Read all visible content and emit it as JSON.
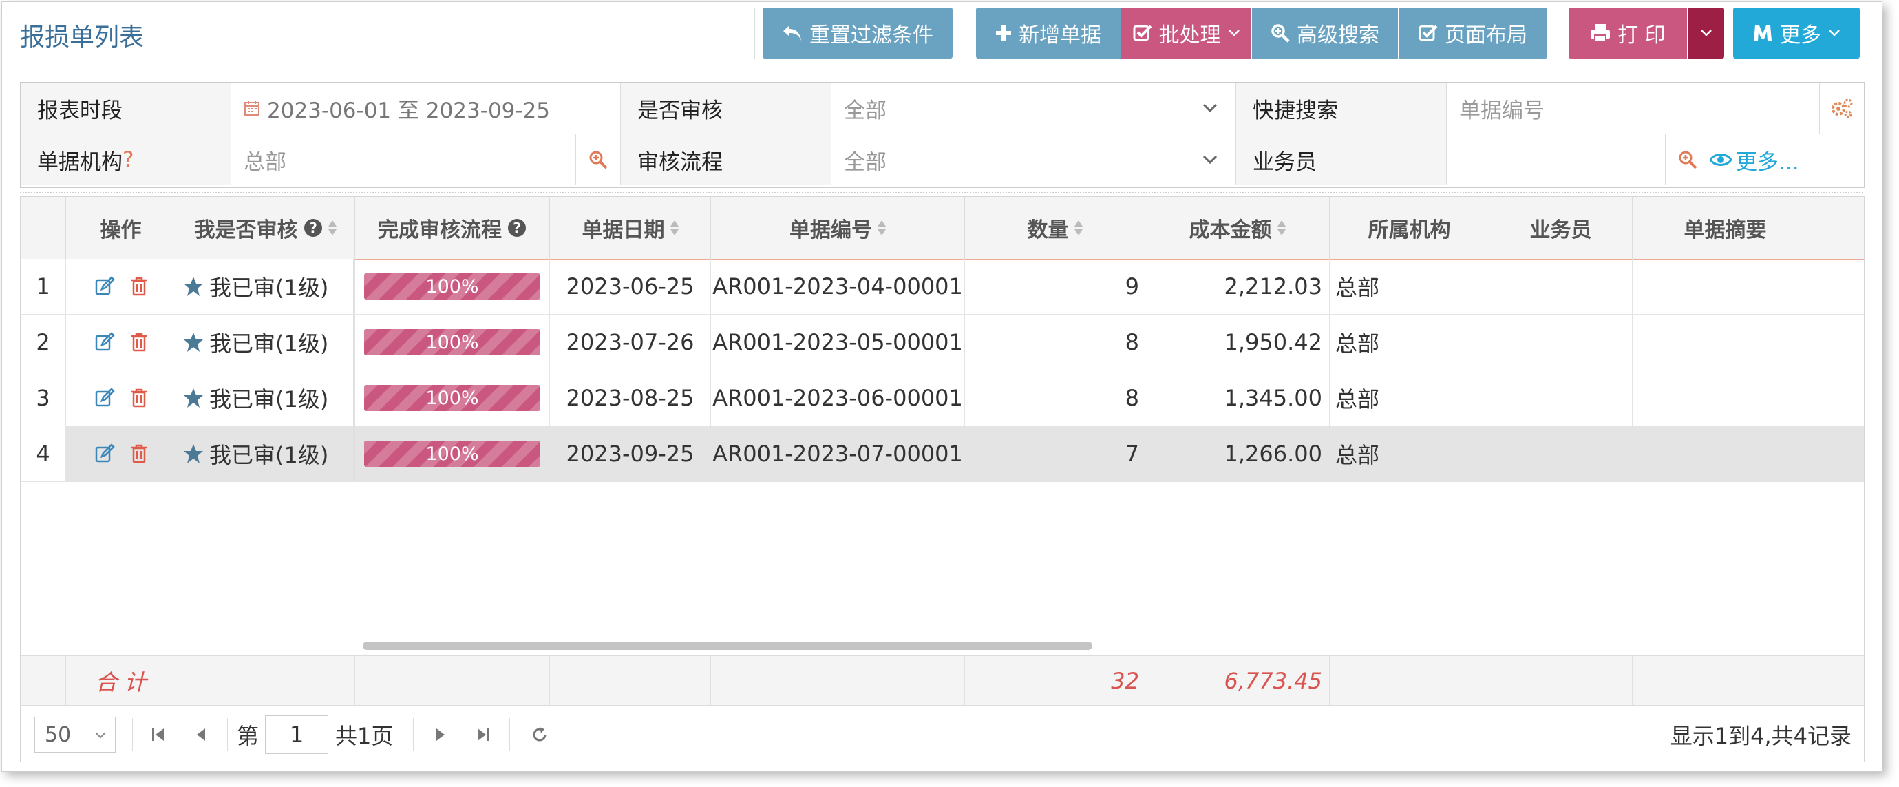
{
  "page": {
    "title": "报损单列表"
  },
  "toolbar": {
    "reset": "重置过滤条件",
    "add": "新增单据",
    "batch": "批处理",
    "advanced_search": "高级搜索",
    "layout": "页面布局",
    "print": "打 印",
    "more": "更多"
  },
  "filters": {
    "period_label": "报表时段",
    "period_value": "2023-06-01 至 2023-09-25",
    "audited_label": "是否审核",
    "audited_value": "全部",
    "quick_label": "快捷搜索",
    "quick_placeholder": "单据编号",
    "org_label": "单据机构",
    "org_q": "?",
    "org_value": "总部",
    "flow_label": "审核流程",
    "flow_value": "全部",
    "staff_label": "业务员",
    "more_link": "更多..."
  },
  "table": {
    "headers": {
      "op": "操作",
      "audited": "我是否审核",
      "flow": "完成审核流程",
      "date": "单据日期",
      "no": "单据编号",
      "qty": "数量",
      "cost": "成本金额",
      "org": "所属机构",
      "staff": "业务员",
      "summary": "单据摘要"
    },
    "rows": [
      {
        "idx": "1",
        "audited": "我已审(1级)",
        "progress": "100%",
        "date": "2023-06-25",
        "no": "AR001-2023-04-00001",
        "qty": "9",
        "cost": "2,212.03",
        "org": "总部",
        "staff": "",
        "summary": ""
      },
      {
        "idx": "2",
        "audited": "我已审(1级)",
        "progress": "100%",
        "date": "2023-07-26",
        "no": "AR001-2023-05-00001",
        "qty": "8",
        "cost": "1,950.42",
        "org": "总部",
        "staff": "",
        "summary": ""
      },
      {
        "idx": "3",
        "audited": "我已审(1级)",
        "progress": "100%",
        "date": "2023-08-25",
        "no": "AR001-2023-06-00001",
        "qty": "8",
        "cost": "1,345.00",
        "org": "总部",
        "staff": "",
        "summary": ""
      },
      {
        "idx": "4",
        "audited": "我已审(1级)",
        "progress": "100%",
        "date": "2023-09-25",
        "no": "AR001-2023-07-00001",
        "qty": "7",
        "cost": "1,266.00",
        "org": "总部",
        "staff": "",
        "summary": ""
      }
    ],
    "footer": {
      "label": "合 计",
      "qty": "32",
      "cost": "6,773.45"
    }
  },
  "pager": {
    "page_size": "50",
    "page_prefix": "第",
    "page": "1",
    "page_suffix": "共1页",
    "info": "显示1到4,共4记录"
  },
  "colors": {
    "blue": "#6aa3c2",
    "pink": "#c9577f",
    "dark_red": "#9d1f45",
    "cyan": "#23a9d8",
    "title": "#3a6f9a",
    "total_red": "#d9534f"
  }
}
